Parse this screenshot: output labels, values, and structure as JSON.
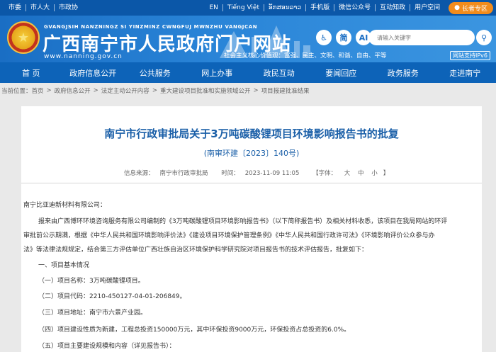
{
  "topbar": {
    "links": [
      "市委",
      "市人大",
      "市政协"
    ],
    "right_links": [
      "EN",
      "Tiếng Việt",
      "ອັກສອນລາວ",
      "手机版",
      "微信公众号",
      "互动知政",
      "用户空间"
    ],
    "elder_mode": "长者专区"
  },
  "header": {
    "pinyin": "GVANGJSIH NANZNINGZ SI YINZMINZ CWNGFUJ MWNZHU VANGJCAN",
    "title": "广西南宁市人民政府门户网站",
    "url": "www.nanning.gov.cn",
    "slogan": "社会主义核心价值观：富强、民主、文明、和谐、自由、平等",
    "tools": {
      "accessibility_icon": "wheelchair-icon",
      "simplified": "简",
      "ai": "AI"
    },
    "search_placeholder": "请输入关键字",
    "ipv6": "网站支持IPv6"
  },
  "nav": [
    "首 页",
    "政府信息公开",
    "公共服务",
    "网上办事",
    "政民互动",
    "要闻回应",
    "政务服务",
    "走进南宁"
  ],
  "breadcrumb": {
    "label": "当前位置：",
    "items": [
      "首页",
      "政府信息公开",
      "法定主动公开内容",
      "重大建设项目批准和实施领域公开",
      "项目报建批准结果"
    ]
  },
  "doc": {
    "title": "南宁市行政审批局关于3万吨碳酸锂项目环境影响报告书的批复",
    "number": "(南审环建〔2023〕140号)",
    "source_label": "信息来源：",
    "source": "南宁市行政审批局",
    "time_label": "时间：",
    "time": "2023-11-09 11:05",
    "font_label": "【字体：",
    "font_large": "大",
    "font_mid": "中",
    "font_small": "小",
    "font_close": "】",
    "addressee": "南宁比亚迪新材料有限公司：",
    "paragraph_lines": [
      "报来由广西博环环境咨询服务有限公司编制的《3万吨碳酸锂项目环境影响报告书》（以下简称报告书）及相关材料收悉，该项目在我局网站的环评",
      "审批前公示期满，根据《中华人民共和国环境影响评价法》《建设项目环境保护管理条例》《中华人民共和国行政许可法》《环境影响评价公众参与办",
      "法》等法律法规规定，结合第三方评估单位广西壮族自治区环境保护科学研究院对项目报告书的技术评估报告，批复如下："
    ],
    "section_1": "一、项目基本情况",
    "items": [
      "（一）项目名称：3万吨碳酸锂项目。",
      "（二）项目代码：2210-450127-04-01-206849。",
      "（三）项目地址：南宁市六景产业园。",
      "（四）项目建设性质为新建，工程总投资150000万元，其中环保投资9000万元，环保投资占总投资的6.0%。",
      "（五）项目主要建设规模和内容（详见报告书）："
    ]
  }
}
